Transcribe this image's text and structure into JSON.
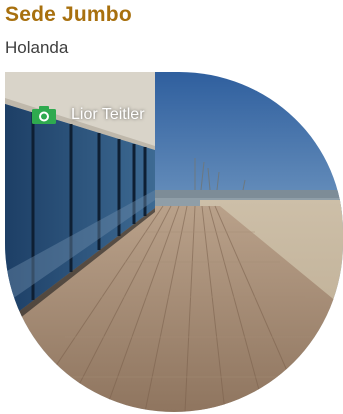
{
  "header": {
    "title": "Sede Jumbo",
    "subtitle": "Holanda"
  },
  "photo": {
    "credit": "Lior Teitler",
    "credit_icon": "camera-icon"
  },
  "colors": {
    "title": "#a8700e",
    "subtitle": "#3e3e3e",
    "icon": "#2faa4f"
  }
}
